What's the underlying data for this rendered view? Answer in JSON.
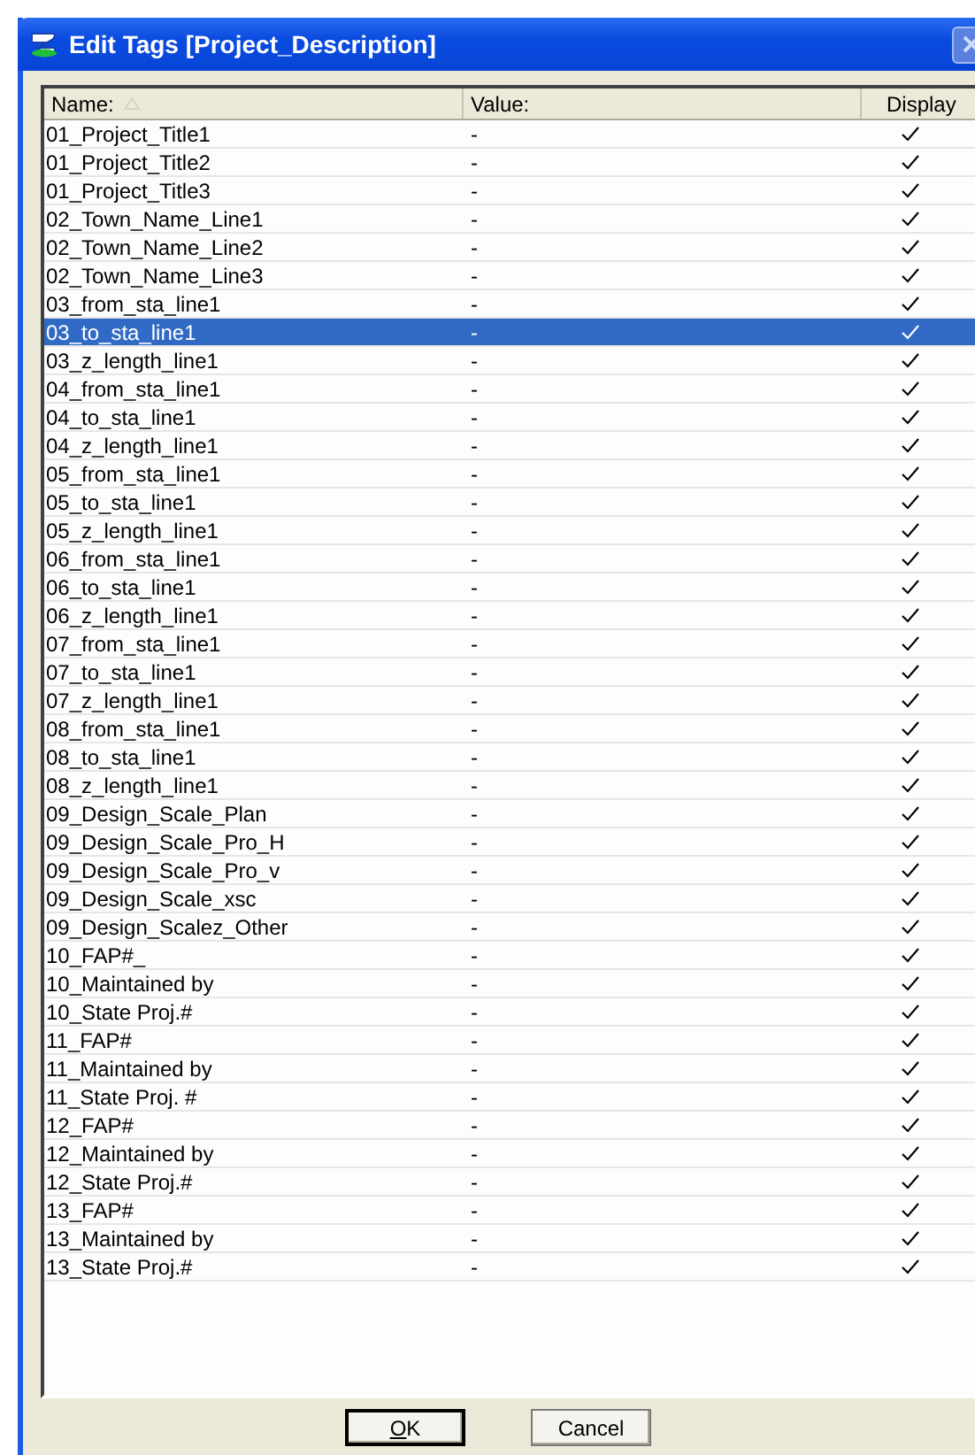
{
  "window": {
    "title": "Edit Tags [Project_Description]"
  },
  "table": {
    "columns": [
      "Name:",
      "Value:",
      "Display"
    ],
    "rows": [
      {
        "name": "01_Project_Title1",
        "value": "-",
        "display": true,
        "selected": false
      },
      {
        "name": "01_Project_Title2",
        "value": "-",
        "display": true,
        "selected": false
      },
      {
        "name": "01_Project_Title3",
        "value": "-",
        "display": true,
        "selected": false
      },
      {
        "name": "02_Town_Name_Line1",
        "value": "-",
        "display": true,
        "selected": false
      },
      {
        "name": "02_Town_Name_Line2",
        "value": "-",
        "display": true,
        "selected": false
      },
      {
        "name": "02_Town_Name_Line3",
        "value": "-",
        "display": true,
        "selected": false
      },
      {
        "name": "03_from_sta_line1",
        "value": "-",
        "display": true,
        "selected": false
      },
      {
        "name": "03_to_sta_line1",
        "value": "-",
        "display": true,
        "selected": true
      },
      {
        "name": "03_z_length_line1",
        "value": "-",
        "display": true,
        "selected": false
      },
      {
        "name": "04_from_sta_line1",
        "value": "-",
        "display": true,
        "selected": false
      },
      {
        "name": "04_to_sta_line1",
        "value": "-",
        "display": true,
        "selected": false
      },
      {
        "name": "04_z_length_line1",
        "value": "-",
        "display": true,
        "selected": false
      },
      {
        "name": "05_from_sta_line1",
        "value": "-",
        "display": true,
        "selected": false
      },
      {
        "name": "05_to_sta_line1",
        "value": "-",
        "display": true,
        "selected": false
      },
      {
        "name": "05_z_length_line1",
        "value": "-",
        "display": true,
        "selected": false
      },
      {
        "name": "06_from_sta_line1",
        "value": "-",
        "display": true,
        "selected": false
      },
      {
        "name": "06_to_sta_line1",
        "value": "-",
        "display": true,
        "selected": false
      },
      {
        "name": "06_z_length_line1",
        "value": "-",
        "display": true,
        "selected": false
      },
      {
        "name": "07_from_sta_line1",
        "value": "-",
        "display": true,
        "selected": false
      },
      {
        "name": "07_to_sta_line1",
        "value": "-",
        "display": true,
        "selected": false
      },
      {
        "name": "07_z_length_line1",
        "value": "-",
        "display": true,
        "selected": false
      },
      {
        "name": "08_from_sta_line1",
        "value": "-",
        "display": true,
        "selected": false
      },
      {
        "name": "08_to_sta_line1",
        "value": "-",
        "display": true,
        "selected": false
      },
      {
        "name": "08_z_length_line1",
        "value": "-",
        "display": true,
        "selected": false
      },
      {
        "name": "09_Design_Scale_Plan",
        "value": "-",
        "display": true,
        "selected": false
      },
      {
        "name": "09_Design_Scale_Pro_H",
        "value": "-",
        "display": true,
        "selected": false
      },
      {
        "name": "09_Design_Scale_Pro_v",
        "value": "-",
        "display": true,
        "selected": false
      },
      {
        "name": "09_Design_Scale_xsc",
        "value": "-",
        "display": true,
        "selected": false
      },
      {
        "name": "09_Design_Scalez_Other",
        "value": "-",
        "display": true,
        "selected": false
      },
      {
        "name": "10_FAP#_",
        "value": "-",
        "display": true,
        "selected": false
      },
      {
        "name": "10_Maintained by",
        "value": "-",
        "display": true,
        "selected": false
      },
      {
        "name": "10_State Proj.#",
        "value": "-",
        "display": true,
        "selected": false
      },
      {
        "name": "11_FAP#",
        "value": "-",
        "display": true,
        "selected": false
      },
      {
        "name": "11_Maintained by",
        "value": "-",
        "display": true,
        "selected": false
      },
      {
        "name": "11_State Proj. #",
        "value": "-",
        "display": true,
        "selected": false
      },
      {
        "name": "12_FAP#",
        "value": "-",
        "display": true,
        "selected": false
      },
      {
        "name": "12_Maintained by",
        "value": "-",
        "display": true,
        "selected": false
      },
      {
        "name": "12_State Proj.#",
        "value": "-",
        "display": true,
        "selected": false
      },
      {
        "name": "13_FAP#",
        "value": "-",
        "display": true,
        "selected": false
      },
      {
        "name": "13_Maintained by",
        "value": "-",
        "display": true,
        "selected": false
      },
      {
        "name": "13_State Proj.#",
        "value": "-",
        "display": true,
        "selected": false
      }
    ]
  },
  "buttons": [
    {
      "label": "OK",
      "default": true,
      "access_key_underlined": true
    },
    {
      "label": "Cancel",
      "default": false,
      "access_key_underlined": false
    }
  ]
}
